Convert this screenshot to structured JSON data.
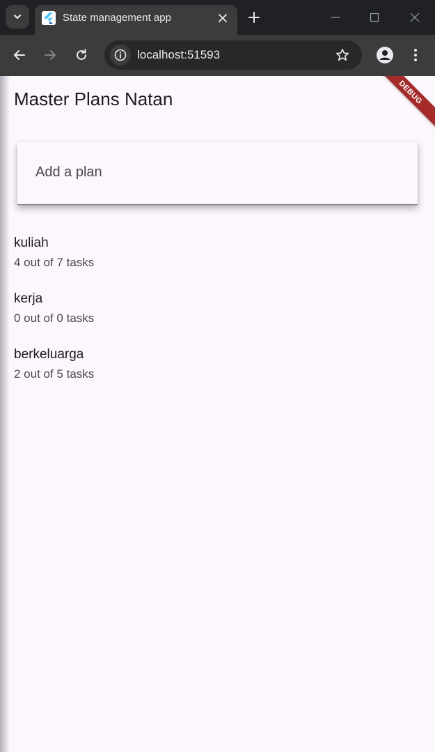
{
  "browser": {
    "tab_title": "State management app",
    "url": "localhost:51593",
    "icons": {
      "tab_search": "chevron-down-icon",
      "tab_close": "close-icon",
      "new_tab": "plus-icon",
      "minimize": "minimize-icon",
      "maximize": "maximize-icon",
      "close_window": "close-window-icon",
      "back": "back-arrow-icon",
      "forward": "forward-arrow-icon",
      "reload": "reload-icon",
      "site_info": "info-icon",
      "bookmark": "star-icon",
      "profile": "profile-icon",
      "menu": "kebab-menu-icon"
    }
  },
  "app": {
    "title": "Master Plans Natan",
    "debug_banner": "DEBUG",
    "add_plan_placeholder": "Add a plan",
    "plans": [
      {
        "name": "kuliah",
        "progress": "4 out of 7 tasks"
      },
      {
        "name": "kerja",
        "progress": "0 out of 0 tasks"
      },
      {
        "name": "berkeluarga",
        "progress": "2 out of 5 tasks"
      }
    ]
  },
  "colors": {
    "chrome_dark": "#202124",
    "chrome_toolbar": "#3c3c3c",
    "app_background": "#fcf6fd",
    "debug_banner": "#a52a2a",
    "text_primary": "#1d1b20",
    "text_secondary": "#49454f"
  }
}
